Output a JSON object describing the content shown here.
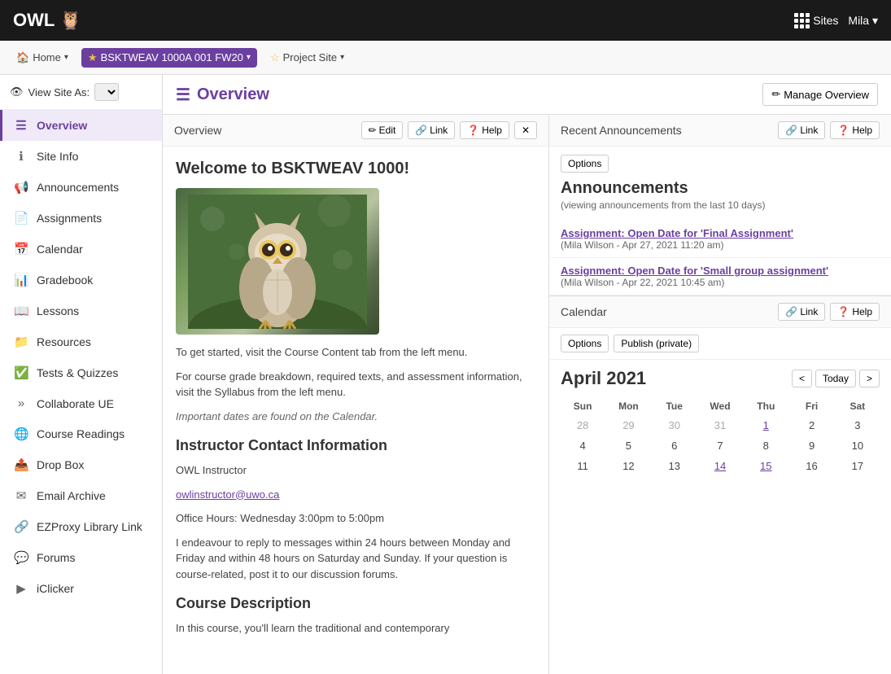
{
  "topnav": {
    "logo": "OWL",
    "sites_label": "Sites",
    "user_label": "Mila ▾"
  },
  "breadcrumb": {
    "home_label": "Home",
    "course_label": "BSKTWEAV 1000A 001 FW20",
    "project_label": "Project Site"
  },
  "sidebar": {
    "view_site_as": "View Site As:",
    "items": [
      {
        "id": "overview",
        "label": "Overview",
        "icon": "☰",
        "active": true
      },
      {
        "id": "site-info",
        "label": "Site Info",
        "icon": "ℹ"
      },
      {
        "id": "announcements",
        "label": "Announcements",
        "icon": "📢"
      },
      {
        "id": "assignments",
        "label": "Assignments",
        "icon": "📄"
      },
      {
        "id": "calendar",
        "label": "Calendar",
        "icon": "📅"
      },
      {
        "id": "gradebook",
        "label": "Gradebook",
        "icon": "📊"
      },
      {
        "id": "lessons",
        "label": "Lessons",
        "icon": "📖"
      },
      {
        "id": "resources",
        "label": "Resources",
        "icon": "📁"
      },
      {
        "id": "tests-quizzes",
        "label": "Tests & Quizzes",
        "icon": "✅"
      },
      {
        "id": "collaborate-ue",
        "label": "Collaborate UE",
        "icon": "»"
      },
      {
        "id": "course-readings",
        "label": "Course Readings",
        "icon": "🌐"
      },
      {
        "id": "drop-box",
        "label": "Drop Box",
        "icon": "📤"
      },
      {
        "id": "email-archive",
        "label": "Email Archive",
        "icon": "✉"
      },
      {
        "id": "ezproxy",
        "label": "EZProxy Library Link",
        "icon": "🔗"
      },
      {
        "id": "forums",
        "label": "Forums",
        "icon": "💬"
      },
      {
        "id": "iclicker",
        "label": "iClicker",
        "icon": "▶"
      }
    ]
  },
  "content_header": {
    "title": "Overview",
    "manage_btn": "Manage Overview"
  },
  "overview_panel": {
    "panel_title": "Overview",
    "edit_btn": "Edit",
    "link_btn": "Link",
    "help_btn": "Help",
    "welcome_title": "Welcome to BSKTWEAV 1000!",
    "text1": "To get started, visit the Course Content tab from the left menu.",
    "text2": "For course grade breakdown, required texts, and assessment information, visit the Syllabus from the left menu.",
    "text3": "Important dates are found on the Calendar.",
    "instructor_title": "Instructor Contact Information",
    "instructor_name": "OWL Instructor",
    "instructor_email": "owlinstructor@uwo.ca",
    "office_hours": "Office Hours: Wednesday 3:00pm to 5:00pm",
    "reply_text": "I endeavour to reply to messages within 24 hours between Monday and Friday and within 48 hours on Saturday and Sunday. If your question is course-related, post it to our discussion forums.",
    "course_desc_title": "Course Description",
    "course_desc_text": "In this course, you'll learn the traditional and contemporary"
  },
  "announcements_panel": {
    "link_btn": "Link",
    "help_btn": "Help",
    "options_btn": "Options",
    "title": "Announcements",
    "subtitle": "(viewing announcements from the last 10 days)",
    "items": [
      {
        "link": "Assignment: Open Date for 'Final Assignment'",
        "meta": "(Mila Wilson - Apr 27, 2021 11:20 am)"
      },
      {
        "link": "Assignment: Open Date for 'Small group assignment'",
        "meta": "(Mila Wilson - Apr 22, 2021 10:45 am)"
      }
    ]
  },
  "calendar_panel": {
    "title": "Calendar",
    "link_btn": "Link",
    "help_btn": "Help",
    "options_btn": "Options",
    "publish_btn": "Publish (private)",
    "month_title": "April 2021",
    "prev_btn": "<",
    "today_btn": "Today",
    "next_btn": ">",
    "day_headers": [
      "Sun",
      "Mon",
      "Tue",
      "Wed",
      "Thu",
      "Fri",
      "Sat"
    ],
    "weeks": [
      [
        {
          "day": "28",
          "gray": true
        },
        {
          "day": "29",
          "gray": true
        },
        {
          "day": "30",
          "gray": true
        },
        {
          "day": "31",
          "gray": true
        },
        {
          "day": "1",
          "event": true
        },
        {
          "day": "2"
        },
        {
          "day": "3"
        }
      ],
      [
        {
          "day": "4"
        },
        {
          "day": "5"
        },
        {
          "day": "6"
        },
        {
          "day": "7"
        },
        {
          "day": "8"
        },
        {
          "day": "9"
        },
        {
          "day": "10"
        }
      ],
      [
        {
          "day": "11"
        },
        {
          "day": "12"
        },
        {
          "day": "13"
        },
        {
          "day": "14",
          "event": true
        },
        {
          "day": "15",
          "event": true
        },
        {
          "day": "16"
        },
        {
          "day": "17"
        }
      ]
    ]
  }
}
